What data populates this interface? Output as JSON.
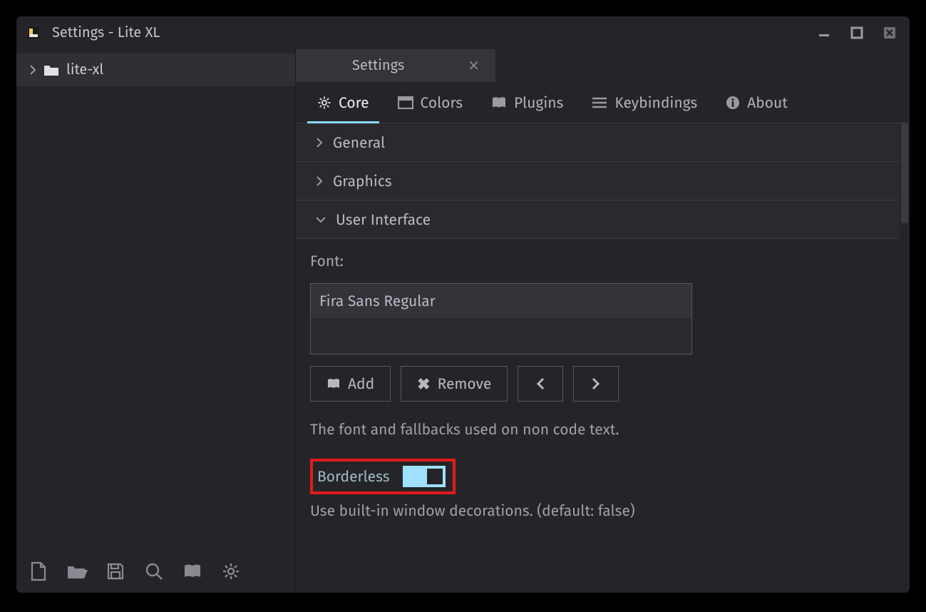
{
  "window": {
    "title": "Settings - Lite XL"
  },
  "sidebar": {
    "tree_root": "lite-xl"
  },
  "editor_tab": {
    "label": "Settings"
  },
  "settings_tabs": {
    "core": "Core",
    "colors": "Colors",
    "plugins": "Plugins",
    "keybindings": "Keybindings",
    "about": "About"
  },
  "sections": {
    "general": "General",
    "graphics": "Graphics",
    "ui": "User Interface"
  },
  "ui_section": {
    "font_label": "Font:",
    "font_items": [
      "Fira Sans Regular"
    ],
    "btn_add": "Add",
    "btn_remove": "Remove",
    "font_desc": "The font and fallbacks used on non code text.",
    "borderless_label": "Borderless",
    "borderless_on": true,
    "borderless_caption": "Use built-in window decorations. (default: false)"
  }
}
